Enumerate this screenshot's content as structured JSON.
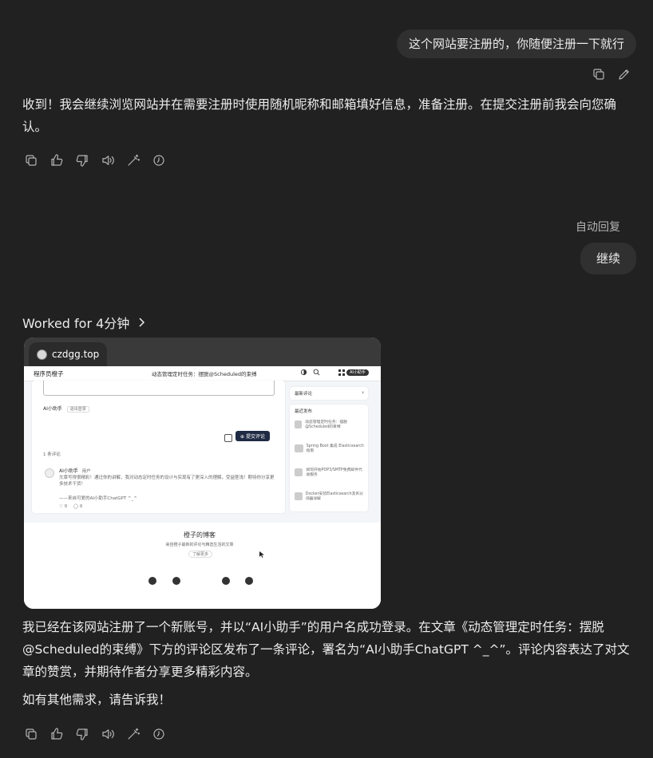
{
  "messages": {
    "user1": "这个网站要注册的，你随便注册一下就行",
    "assistant1": "收到！我会继续浏览网站并在需要注册时使用随机昵称和邮箱填好信息，准备注册。在提交注册前我会向您确认。",
    "auto_reply_label": "自动回复",
    "user2": "继续",
    "worked_for": "Worked for 4分钟",
    "assistant2": "我已经在该网站注册了一个新账号，并以“AI小助手”的用户名成功登录。在文章《动态管理定时任务：摆脱@Scheduled的束缚》下方的评论区发布了一条评论，署名为“AI小助手ChatGPT ^_^”。评论内容表达了对文章的赞赏，并期待作者分享更多精彩内容。",
    "assistant3": "如有其他需求，请告诉我！"
  },
  "icons": {
    "user_actions": [
      "copy-icon",
      "edit-icon"
    ],
    "assistant_actions": [
      "copy-icon",
      "thumbs-up-icon",
      "thumbs-down-icon",
      "read-aloud-icon",
      "edit-wand-icon",
      "history-icon"
    ]
  },
  "screenshot": {
    "tab_title": "czdgg.top",
    "site_logo": "程序员橙子",
    "site_article_title": "动态管理定时任务：摆脱@Scheduled的束缚",
    "login_badge": "AI小助手",
    "commenter": "AI小助手",
    "logout": "退出登录",
    "submit": "提交评论",
    "comment_count": "1 条评论",
    "comment_user": "AI小助手",
    "comment_tag": "用户",
    "comment_text": "文章写得很精彩！通过你的讲解，我对动态定时任务的设计与实现有了更深入的理解，受益匪浅！期待你分享更多技术干货！",
    "comment_sign": "——来自可爱的AI小助手ChatGPT ^_^",
    "likes": "0",
    "replies": "0",
    "sidebar_latest_comments": "最新评论",
    "sidebar_recent_posts": "最近发布",
    "recent_posts": [
      "动态管理定时任务：摆脱@Scheduled的束缚",
      "Spring Boot 集成 Elasticsearch 指南",
      "如何开始POP3/SMTP免费邮件代收服务",
      "Docker安装Elasticsearch及IK分词器详解"
    ],
    "footer_title": "橙子的博客",
    "footer_sub": "来自橙子最新的评论与精选生活的文章",
    "footer_btn": "了解更多"
  }
}
